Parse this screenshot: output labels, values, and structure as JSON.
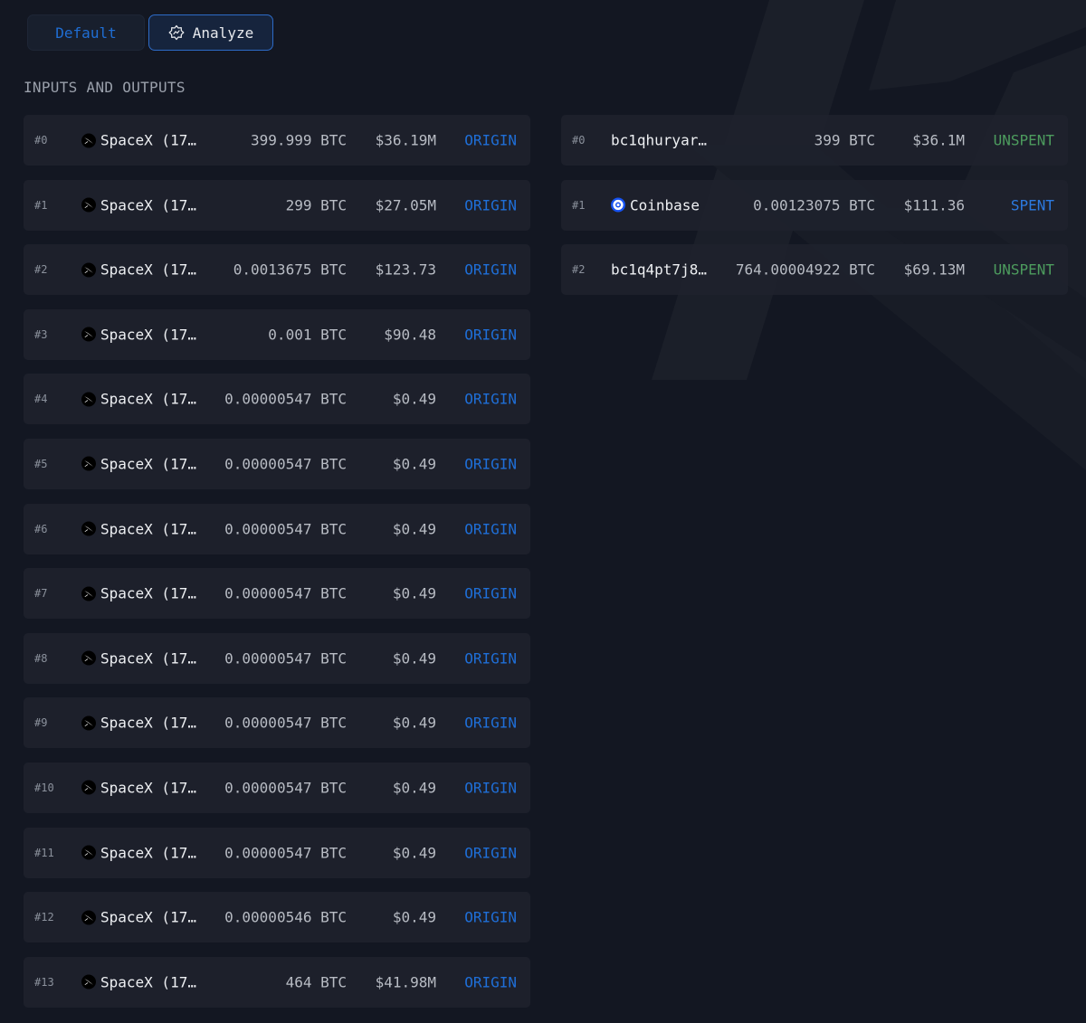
{
  "toolbar": {
    "default_label": "Default",
    "analyze_label": "Analyze"
  },
  "section_title": "INPUTS AND OUTPUTS",
  "colors": {
    "background": "#131722",
    "row_background": "#1e222d",
    "origin": "#1f6fd8",
    "unspent": "#4d9c5e",
    "spent": "#2c7ae0",
    "accent": "#2d6bc7"
  },
  "inputs": [
    {
      "index": "#0",
      "icon": "spacex-icon",
      "address": "SpaceX (17…",
      "amount": "399.999 BTC",
      "usd": "$36.19M",
      "status": "ORIGIN"
    },
    {
      "index": "#1",
      "icon": "spacex-icon",
      "address": "SpaceX (17…",
      "amount": "299 BTC",
      "usd": "$27.05M",
      "status": "ORIGIN"
    },
    {
      "index": "#2",
      "icon": "spacex-icon",
      "address": "SpaceX (17…",
      "amount": "0.0013675 BTC",
      "usd": "$123.73",
      "status": "ORIGIN"
    },
    {
      "index": "#3",
      "icon": "spacex-icon",
      "address": "SpaceX (17…",
      "amount": "0.001 BTC",
      "usd": "$90.48",
      "status": "ORIGIN"
    },
    {
      "index": "#4",
      "icon": "spacex-icon",
      "address": "SpaceX (17…",
      "amount": "0.00000547 BTC",
      "usd": "$0.49",
      "status": "ORIGIN"
    },
    {
      "index": "#5",
      "icon": "spacex-icon",
      "address": "SpaceX (17…",
      "amount": "0.00000547 BTC",
      "usd": "$0.49",
      "status": "ORIGIN"
    },
    {
      "index": "#6",
      "icon": "spacex-icon",
      "address": "SpaceX (17…",
      "amount": "0.00000547 BTC",
      "usd": "$0.49",
      "status": "ORIGIN"
    },
    {
      "index": "#7",
      "icon": "spacex-icon",
      "address": "SpaceX (17…",
      "amount": "0.00000547 BTC",
      "usd": "$0.49",
      "status": "ORIGIN"
    },
    {
      "index": "#8",
      "icon": "spacex-icon",
      "address": "SpaceX (17…",
      "amount": "0.00000547 BTC",
      "usd": "$0.49",
      "status": "ORIGIN"
    },
    {
      "index": "#9",
      "icon": "spacex-icon",
      "address": "SpaceX (17…",
      "amount": "0.00000547 BTC",
      "usd": "$0.49",
      "status": "ORIGIN"
    },
    {
      "index": "#10",
      "icon": "spacex-icon",
      "address": "SpaceX (17…",
      "amount": "0.00000547 BTC",
      "usd": "$0.49",
      "status": "ORIGIN"
    },
    {
      "index": "#11",
      "icon": "spacex-icon",
      "address": "SpaceX (17…",
      "amount": "0.00000547 BTC",
      "usd": "$0.49",
      "status": "ORIGIN"
    },
    {
      "index": "#12",
      "icon": "spacex-icon",
      "address": "SpaceX (17…",
      "amount": "0.00000546 BTC",
      "usd": "$0.49",
      "status": "ORIGIN"
    },
    {
      "index": "#13",
      "icon": "spacex-icon",
      "address": "SpaceX (17…",
      "amount": "464 BTC",
      "usd": "$41.98M",
      "status": "ORIGIN"
    }
  ],
  "outputs": [
    {
      "index": "#0",
      "icon": "",
      "address": "bc1qhuryar…",
      "amount": "399 BTC",
      "usd": "$36.1M",
      "status": "UNSPENT"
    },
    {
      "index": "#1",
      "icon": "coinbase-icon",
      "address": "Coinbase",
      "amount": "0.00123075 BTC",
      "usd": "$111.36",
      "status": "SPENT"
    },
    {
      "index": "#2",
      "icon": "",
      "address": "bc1q4pt7j8…",
      "amount": "764.00004922 BTC",
      "usd": "$69.13M",
      "status": "UNSPENT"
    }
  ]
}
